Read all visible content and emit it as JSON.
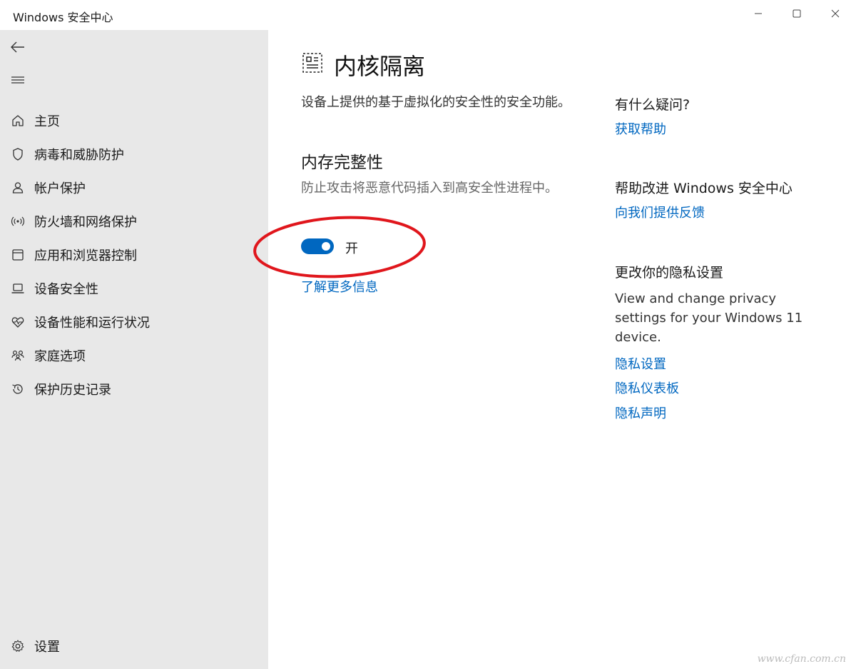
{
  "window": {
    "title": "Windows 安全中心"
  },
  "sidebar": {
    "items": [
      {
        "label": "主页",
        "icon": "home-icon"
      },
      {
        "label": "病毒和威胁防护",
        "icon": "shield-icon"
      },
      {
        "label": "帐户保护",
        "icon": "person-icon"
      },
      {
        "label": "防火墙和网络保护",
        "icon": "wifi-signal-icon"
      },
      {
        "label": "应用和浏览器控制",
        "icon": "app-window-icon"
      },
      {
        "label": "设备安全性",
        "icon": "laptop-icon"
      },
      {
        "label": "设备性能和运行状况",
        "icon": "heartbeat-icon"
      },
      {
        "label": "家庭选项",
        "icon": "family-icon"
      },
      {
        "label": "保护历史记录",
        "icon": "history-icon"
      }
    ],
    "settings_label": "设置"
  },
  "main": {
    "title": "内核隔离",
    "description": "设备上提供的基于虚拟化的安全性的安全功能。",
    "section": {
      "title": "内存完整性",
      "description": "防止攻击将恶意代码插入到高安全性进程中。",
      "toggle_state": "开",
      "toggle_on": true,
      "learn_more": "了解更多信息"
    }
  },
  "right": {
    "q_heading": "有什么疑问?",
    "help_link": "获取帮助",
    "improve_heading": "帮助改进 Windows 安全中心",
    "feedback_link": "向我们提供反馈",
    "privacy_heading": "更改你的隐私设置",
    "privacy_text": "View and change privacy settings for your Windows 11 device.",
    "privacy_links": [
      "隐私设置",
      "隐私仪表板",
      "隐私声明"
    ]
  },
  "watermark": "www.cfan.com.cn",
  "colors": {
    "accent": "#0067c0",
    "sidebar_bg": "#e8e8e8",
    "annotation": "#e0161c"
  }
}
